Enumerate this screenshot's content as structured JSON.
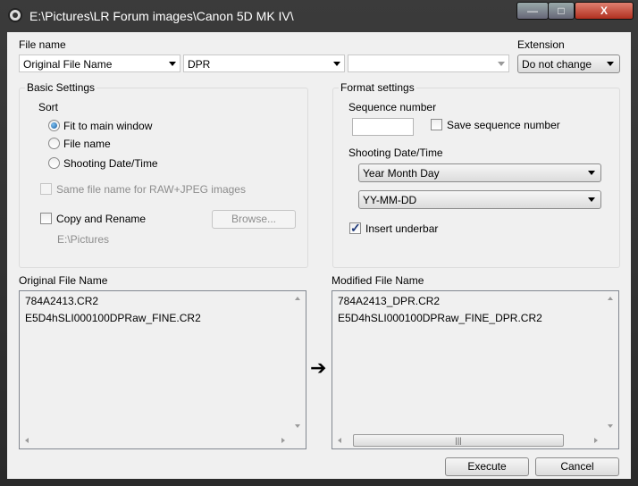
{
  "window": {
    "title": "E:\\Pictures\\LR Forum images\\Canon 5D MK IV\\",
    "minimize_label": "—",
    "maximize_label": "□",
    "close_label": "X"
  },
  "file_name": {
    "label": "File name",
    "part1": "Original File Name",
    "part2": "DPR",
    "part3": ""
  },
  "extension": {
    "label": "Extension",
    "value": "Do not change"
  },
  "basic_settings": {
    "title": "Basic Settings",
    "sort_label": "Sort",
    "sort_options": [
      {
        "label": "Fit to main window",
        "checked": true
      },
      {
        "label": "File name",
        "checked": false
      },
      {
        "label": "Shooting Date/Time",
        "checked": false
      }
    ],
    "same_file_name_label": "Same file name for RAW+JPEG images",
    "copy_rename_label": "Copy and Rename",
    "browse_label": "Browse...",
    "path": "E:\\Pictures"
  },
  "format_settings": {
    "title": "Format settings",
    "sequence_number_label": "Sequence number",
    "sequence_number_value": "",
    "save_sequence_label": "Save sequence number",
    "shooting_date_label": "Shooting Date/Time",
    "date_order": "Year Month Day",
    "date_format": "YY-MM-DD",
    "insert_underbar_label": "Insert underbar",
    "insert_underbar_checked": true
  },
  "original_list": {
    "label": "Original File Name",
    "items": [
      "784A2413.CR2",
      "E5D4hSLI000100DPRaw_FINE.CR2"
    ]
  },
  "modified_list": {
    "label": "Modified File Name",
    "items": [
      "784A2413_DPR.CR2",
      "E5D4hSLI000100DPRaw_FINE_DPR.CR2"
    ]
  },
  "arrow_icon": "➔",
  "buttons": {
    "execute": "Execute",
    "cancel": "Cancel"
  }
}
